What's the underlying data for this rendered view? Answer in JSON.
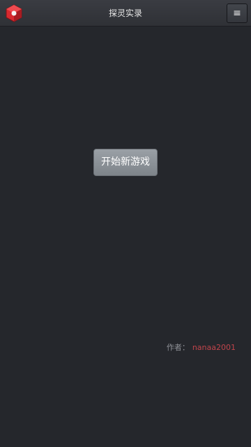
{
  "header": {
    "title": "探灵实录",
    "menu_icon": "menu-icon",
    "menu_glyph": "≡",
    "logo_icon": "app-logo-icon"
  },
  "main": {
    "start_button_label": "开始新游戏"
  },
  "footer": {
    "author_label": "作者：",
    "author_name": "nanaa2001"
  },
  "colors": {
    "background": "#25272c",
    "header": "#35373c",
    "button": "#8c9298",
    "author_name": "#c0444b",
    "logo_red": "#d8292f"
  }
}
